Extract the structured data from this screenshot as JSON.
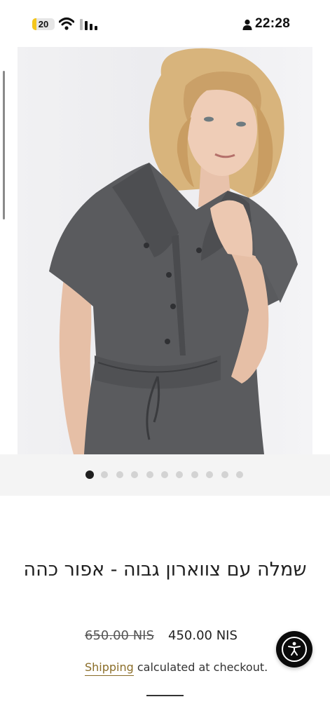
{
  "status_bar": {
    "battery_level": "20",
    "battery_fraction": 0.2,
    "time": "22:28",
    "icons": [
      "battery-icon",
      "wifi-icon",
      "signal-icon",
      "person-icon"
    ],
    "battery_color": "#f4c61d"
  },
  "gallery": {
    "image": "model-wearing-dark-grey-shirt-dress",
    "slide_count": 11,
    "active_slide": 1
  },
  "product": {
    "title": "שמלה עם צווארון גבוה - אפור כהה",
    "compare_at_price": "650.00 NIS",
    "price": "450.00 NIS",
    "shipping_link": "Shipping",
    "shipping_text": " calculated at checkout.",
    "link_color": "#8a6d28"
  },
  "accessibility": {
    "icon": "accessibility-icon"
  }
}
